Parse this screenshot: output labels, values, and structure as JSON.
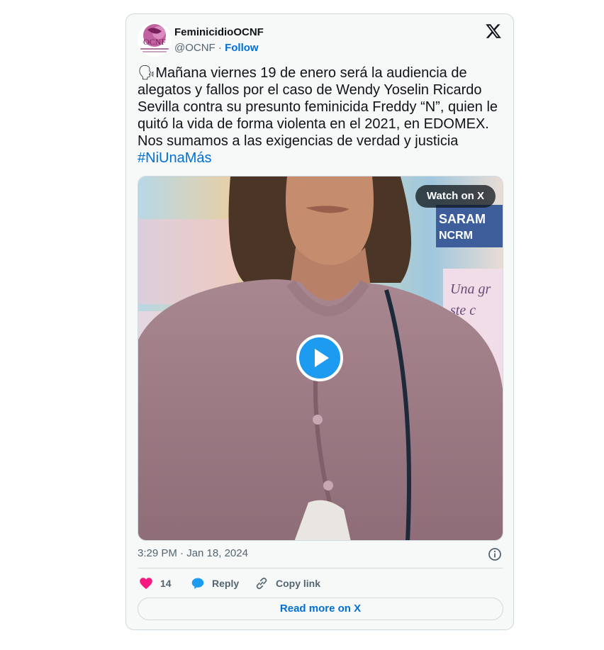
{
  "author": {
    "display_name": "FeminicidioOCNF",
    "handle": "@OCNF",
    "separator": " · ",
    "follow_label": "Follow",
    "avatar_text": "OCNF"
  },
  "tweet": {
    "emoji": "🗣",
    "text": "Mañana viernes 19 de enero será la audiencia de alegatos y fallos por el caso de Wendy Yoselin Ricardo Sevilla contra su presunto feminicida Freddy “N”, quien le quitó la vida de forma violenta en el 2021, en EDOMEX. Nos sumamos a las exigencias de verdad y justicia",
    "hashtag": "#NiUnaMás"
  },
  "media": {
    "watch_label": "Watch on X",
    "sign_text_1": "SARAM",
    "sign_text_2": "NCRM",
    "mural_text_1": "Una gr",
    "mural_text_2": "ste c"
  },
  "meta": {
    "timestamp": "3:29 PM · Jan 18, 2024"
  },
  "actions": {
    "likes": "14",
    "reply_label": "Reply",
    "copy_label": "Copy link"
  },
  "read_more_label": "Read more on X",
  "colors": {
    "link": "#006fd6",
    "like": "#f91880",
    "reply": "#1d9bf0",
    "play": "#1d9bf0"
  }
}
